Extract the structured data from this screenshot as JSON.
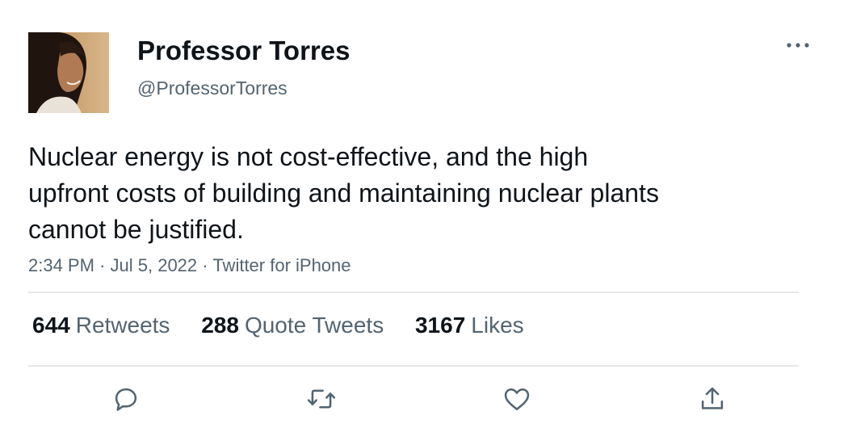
{
  "author": {
    "display_name": "Professor Torres",
    "handle": "@ProfessorTorres"
  },
  "tweet": {
    "text": "Nuclear energy is not cost-effective, and the high upfront costs of building and maintaining nuclear plants cannot be justified.",
    "time": "2:34 PM",
    "date": "Jul 5, 2022",
    "source": "Twitter for iPhone"
  },
  "stats": {
    "retweets": {
      "count": "644",
      "label": "Retweets"
    },
    "quotes": {
      "count": "288",
      "label": "Quote Tweets"
    },
    "likes": {
      "count": "3167",
      "label": "Likes"
    }
  },
  "icons": {
    "more": "more-options-icon",
    "reply": "reply-icon",
    "retweet": "retweet-icon",
    "like": "heart-icon",
    "share": "share-icon"
  },
  "colors": {
    "text": "#0f1419",
    "secondary": "#536471",
    "divider": "#e6e8ea"
  }
}
